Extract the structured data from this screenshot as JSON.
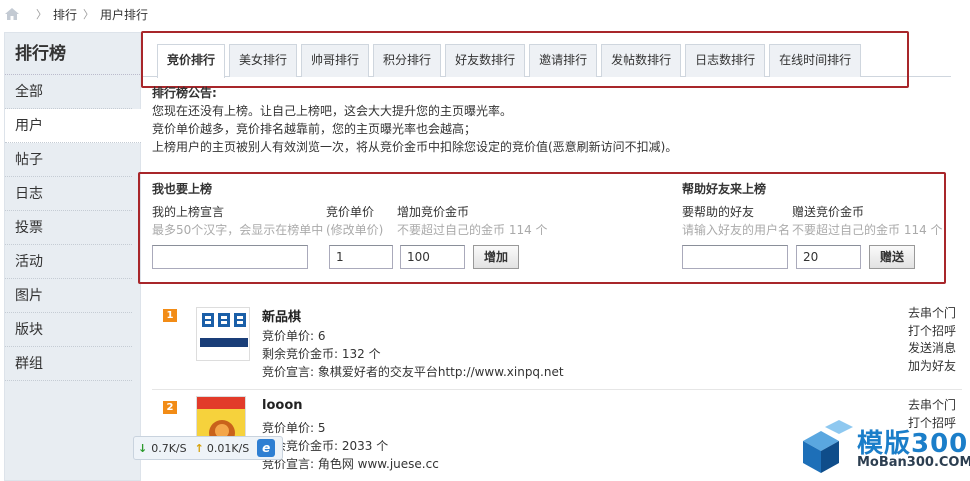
{
  "breadcrumb": {
    "items": [
      "排行",
      "用户排行"
    ]
  },
  "sidebar": {
    "title": "排行榜",
    "items": [
      {
        "label": "全部",
        "active": false
      },
      {
        "label": "用户",
        "active": true
      },
      {
        "label": "帖子",
        "active": false
      },
      {
        "label": "日志",
        "active": false
      },
      {
        "label": "投票",
        "active": false
      },
      {
        "label": "活动",
        "active": false
      },
      {
        "label": "图片",
        "active": false
      },
      {
        "label": "版块",
        "active": false
      },
      {
        "label": "群组",
        "active": false
      }
    ]
  },
  "tabs": [
    {
      "label": "竞价排行",
      "active": true
    },
    {
      "label": "美女排行",
      "active": false
    },
    {
      "label": "帅哥排行",
      "active": false
    },
    {
      "label": "积分排行",
      "active": false
    },
    {
      "label": "好友数排行",
      "active": false
    },
    {
      "label": "邀请排行",
      "active": false
    },
    {
      "label": "发帖数排行",
      "active": false
    },
    {
      "label": "日志数排行",
      "active": false
    },
    {
      "label": "在线时间排行",
      "active": false
    }
  ],
  "notice": {
    "title": "排行榜公告:",
    "lines": [
      "您现在还没有上榜。让自己上榜吧，这会大大提升您的主页曝光率。",
      "竞价单价越多，竞价排名越靠前，您的主页曝光率也会越高；",
      "上榜用户的主页被别人有效浏览一次，将从竞价金币中扣除您设定的竞价值(恶意刷新访问不扣减)。"
    ]
  },
  "self_form": {
    "heading": "我也要上榜",
    "declaration_label": "我的上榜宣言",
    "declaration_hint": "最多50个汉字，会显示在榜单中",
    "declaration_value": "",
    "price_label": "竞价单价",
    "price_hint": "(修改单价)",
    "price_value": "1",
    "coins_label": "增加竞价金币",
    "coins_hint": "不要超过自己的金币 114 个",
    "coins_value": "100",
    "submit_label": "增加"
  },
  "friend_form": {
    "heading": "帮助好友来上榜",
    "friend_label": "要帮助的好友",
    "friend_hint": "请输入好友的用户名",
    "friend_value": "",
    "gift_label": "赠送竞价金币",
    "gift_hint": "不要超过自己的金币 114 个",
    "gift_value": "20",
    "submit_label": "赠送"
  },
  "rank_list": [
    {
      "rank": "1",
      "name": "新品棋",
      "price": "竞价单价: 6",
      "remaining": "剩余竞价金币: 132 个",
      "declaration": "竞价宣言: 象棋爱好者的交友平台http://www.xinpq.net",
      "avatar_text_top": "新品棋",
      "avatar_text_bottom": "www.xinpq.net",
      "actions": [
        "去串个门",
        "打个招呼",
        "发送消息",
        "加为好友"
      ]
    },
    {
      "rank": "2",
      "name": "looon",
      "price": "竞价单价: 5",
      "remaining": "剩余竞价金币: 2033 个",
      "declaration": "竞价宣言: 角色网 www.juese.cc",
      "avatar_text_top": "",
      "avatar_text_bottom": "",
      "actions": [
        "去串个门",
        "打个招呼"
      ]
    }
  ],
  "speed_widget": {
    "down": "0.7K/S",
    "up": "0.01K/S"
  },
  "watermark": {
    "text": "模版300",
    "sub": "MoBan300.COM"
  },
  "colors": {
    "highlight": "#a8262a",
    "rank_badge": "#f28c16",
    "sidebar_bg": "#e8edf2"
  }
}
